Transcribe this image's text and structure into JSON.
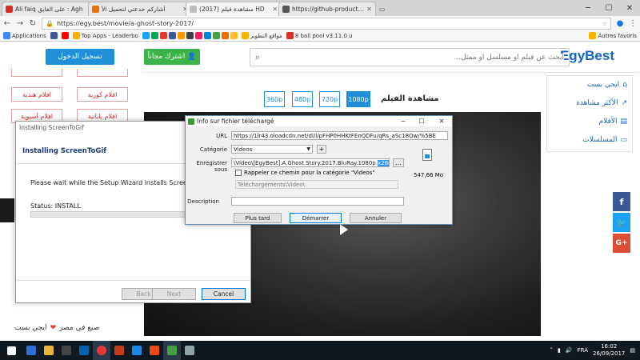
{
  "browser": {
    "tabs": [
      {
        "label": "Ali faiq على الفايق : Agh",
        "color": "#d93025"
      },
      {
        "label": "أشاركم خدعتي لتحميل الأ",
        "color": "#e8710a"
      },
      {
        "label": "مشاهدة فيلم (2017) HD",
        "color": "#bdbdbd"
      },
      {
        "label": "https://github-production",
        "color": "#555555"
      }
    ],
    "user": "Autres favoris",
    "url": "https://egy.best/movie/a-ghost-story-2017/",
    "bookmarks": [
      {
        "label": "Applications",
        "color": "#4285f4"
      },
      {
        "label": "",
        "color": "#3b5998"
      },
      {
        "label": "",
        "color": "#ff0000"
      },
      {
        "label": "Top Apps - Leaderbo",
        "color": "#f4b400"
      },
      {
        "label": "مواقع التطوير",
        "color": "#f4b400"
      },
      {
        "label": "8 ball pool v3.11.0 u",
        "color": "#d93025"
      }
    ],
    "other_bookmarks": "Autres favoris"
  },
  "site": {
    "logo": "EgyBest",
    "search_placeholder": "ابحث عن فيلم او مسلسل او ممثل...",
    "signup": "اشترك مجاناً",
    "login": "تسجيل الدخول",
    "categories": [
      "افلام كورية",
      "افلام هندية",
      "افلام يابانية",
      "افلام آسيوية"
    ],
    "watch_title": "مشاهدة الفيلم",
    "qualities": [
      "1080p",
      "720p",
      "480p",
      "360p"
    ],
    "nav": [
      {
        "label": "ايجي بست",
        "icon": "home-icon"
      },
      {
        "label": "الأكثر مشاهدة",
        "icon": "trending-icon"
      },
      {
        "label": "الأفلام",
        "icon": "film-icon"
      },
      {
        "label": "المسلسلات",
        "icon": "tv-icon"
      }
    ],
    "footer": "ايجي بست",
    "footer_suffix": "صنع في مصر"
  },
  "installer": {
    "window_title": "Installing ScreenToGif",
    "heading": "Installing ScreenToGif",
    "message": "Please wait while the Setup Wizard installs ScreenToGif.",
    "status": "Status: INSTALL",
    "back": "Back",
    "next": "Next",
    "cancel": "Cancel"
  },
  "idm": {
    "title": "Info sur fichier téléchargé",
    "url_label": "URL",
    "url": "https://1lr43.oloadcdn.net/dl/l/pFHP0HHKtFEnQDFu/qRs_aSc18Ow/%5BE",
    "category_label": "Catégorie",
    "category": "Videos",
    "save_label": "Enregistrer sous",
    "save_path": "\\Video\\[EgyBest].A.Ghost.Story.2017.BluRay.1080p.",
    "save_selected": "x264.MP4",
    "remember": "Rappeler ce chemin pour la catégorie \"Videos\"",
    "default_path": "Téléchargements\\Video\\",
    "size": "547,66 Mo",
    "description_label": "Description",
    "later": "Plus tard",
    "start": "Démarrer",
    "cancel": "Annuler"
  },
  "taskbar": {
    "lang": "FRA",
    "time": "16:02",
    "date": "26/09/2017"
  }
}
